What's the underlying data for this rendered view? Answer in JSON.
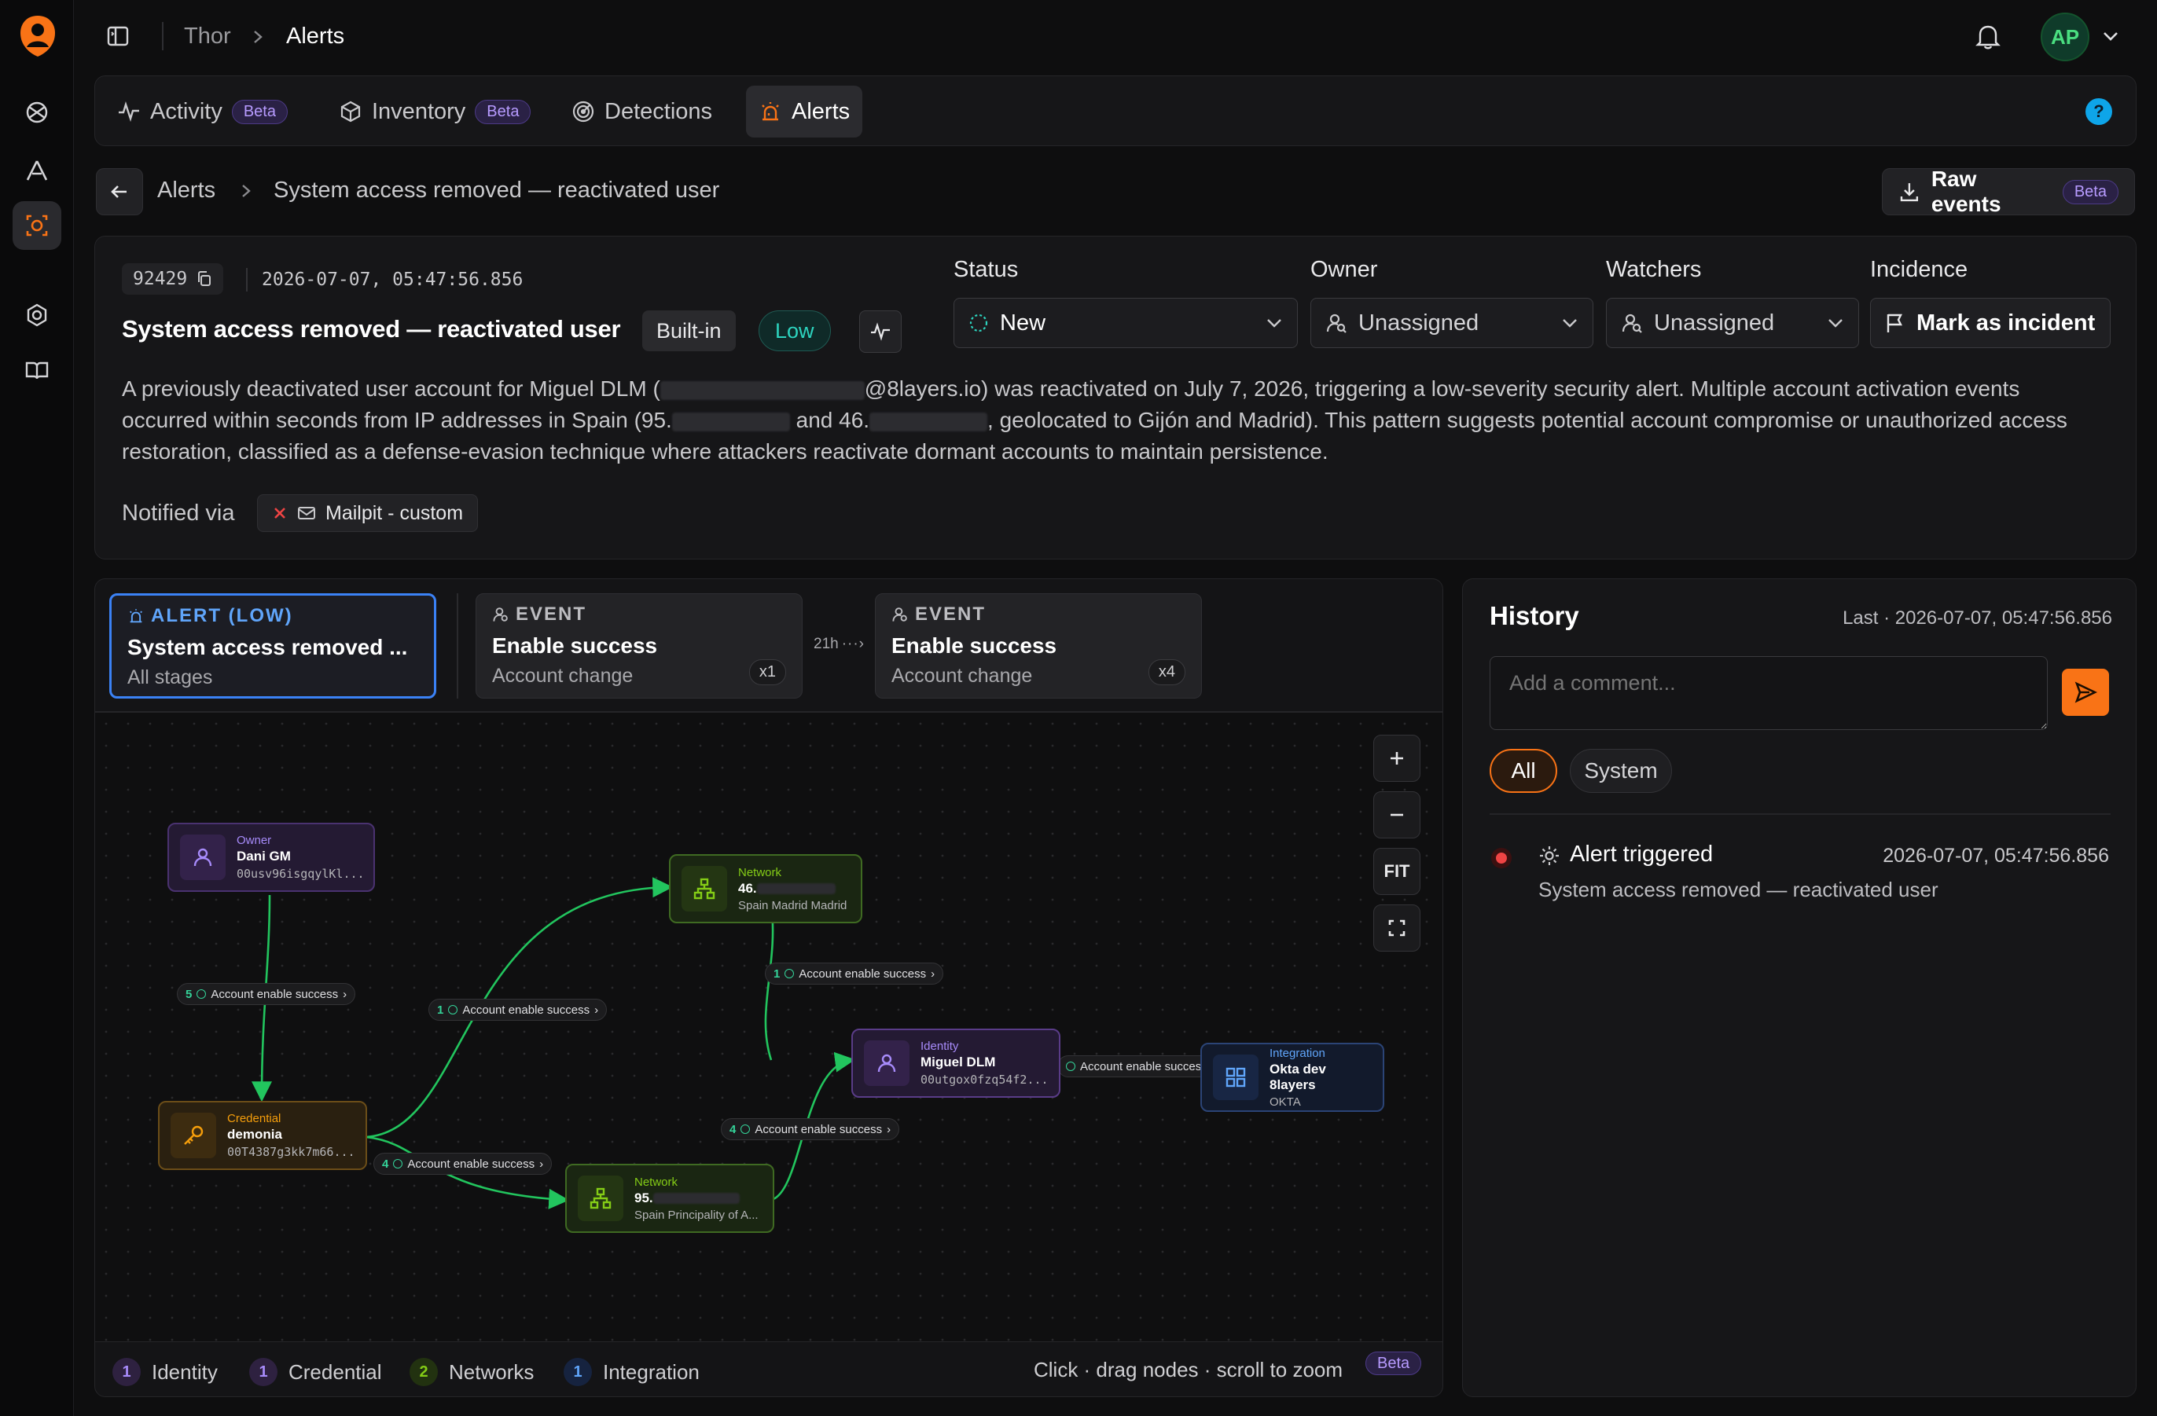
{
  "topbar": {
    "workspace": "Thor",
    "section": "Alerts",
    "avatar_initials": "AP"
  },
  "tabs": [
    {
      "label": "Activity",
      "badge": "Beta",
      "icon": "activity-icon"
    },
    {
      "label": "Inventory",
      "badge": "Beta",
      "icon": "cube-icon"
    },
    {
      "label": "Detections",
      "badge": "",
      "icon": "radar-icon"
    },
    {
      "label": "Alerts",
      "badge": "",
      "icon": "siren-icon",
      "active": true
    }
  ],
  "breadcrumb": {
    "parent": "Alerts",
    "current": "System access removed — reactivated user"
  },
  "raw_events": {
    "label": "Raw events",
    "badge": "Beta"
  },
  "alert": {
    "id": "92429",
    "timestamp": "2026-07-07, 05:47:56.856",
    "title": "System access removed — reactivated user",
    "type_badge": "Built-in",
    "severity": "Low",
    "description": {
      "p1": "A previously deactivated user account for Miguel DLM (",
      "p2": "@8layers.io) was reactivated on July 7, 2026, triggering a low-severity security alert. Multiple account activation events occurred within seconds from IP addresses in Spain (95.",
      "p3": " and 46.",
      "p4": ", geolocated to Gijón and Madrid). This pattern suggests potential account compromise or unauthorized access restoration, classified as a defense-evasion technique where attackers reactivate dormant accounts to maintain persistence."
    },
    "notified_label": "Notified via",
    "notified_channel": "Mailpit - custom"
  },
  "fields": {
    "status_label": "Status",
    "status_value": "New",
    "owner_label": "Owner",
    "owner_value": "Unassigned",
    "watchers_label": "Watchers",
    "watchers_value": "Unassigned",
    "incidence_label": "Incidence",
    "incidence_button": "Mark as incident"
  },
  "timeline": [
    {
      "kind": "ALERT (LOW)",
      "title": "System access removed ...",
      "sub": "All stages",
      "count": ""
    },
    {
      "kind": "EVENT",
      "title": "Enable success",
      "sub": "Account change",
      "count": "x1"
    },
    {
      "kind": "EVENT",
      "title": "Enable success",
      "sub": "Account change",
      "count": "x4"
    }
  ],
  "timeline_gap": "21h",
  "zoom": {
    "fit": "FIT"
  },
  "nodes": {
    "owner": {
      "type": "Owner",
      "name": "Dani GM",
      "sub": "00usv96isgqylKl..."
    },
    "credential": {
      "type": "Credential",
      "name": "demonia",
      "sub": "00T4387g3kk7m66..."
    },
    "network1": {
      "type": "Network",
      "name": "46.",
      "sub": "Spain Madrid Madrid"
    },
    "network2": {
      "type": "Network",
      "name": "95.",
      "sub": "Spain Principality of A..."
    },
    "identity": {
      "type": "Identity",
      "name": "Miguel DLM",
      "sub": "00utgox0fzq54f2..."
    },
    "integration": {
      "type": "Integration",
      "name": "Okta dev 8layers",
      "sub": "OKTA"
    }
  },
  "edges": [
    {
      "count": "5",
      "label": "Account enable success"
    },
    {
      "count": "1",
      "label": "Account enable success"
    },
    {
      "count": "1",
      "label": "Account enable success"
    },
    {
      "count": "4",
      "label": "Account enable success"
    },
    {
      "count": "4",
      "label": "Account enable success"
    },
    {
      "count": "",
      "label": "Account enable success"
    }
  ],
  "legend": [
    {
      "count": "1",
      "label": "Identity",
      "color": "#a78bfa"
    },
    {
      "count": "1",
      "label": "Credential",
      "color": "#a78bfa"
    },
    {
      "count": "2",
      "label": "Networks",
      "color": "#84cc16"
    },
    {
      "count": "1",
      "label": "Integration",
      "color": "#60a5fa"
    }
  ],
  "graph_hint": "Click · drag nodes · scroll to zoom",
  "graph_badge": "Beta",
  "history": {
    "title": "History",
    "last": "Last · 2026-07-07, 05:47:56.856",
    "comment_placeholder": "Add a comment...",
    "filter_all": "All",
    "filter_system": "System",
    "entry_title": "Alert triggered",
    "entry_time": "2026-07-07, 05:47:56.856",
    "entry_sub": "System access removed — reactivated user"
  },
  "colors": {
    "accent": "#f97316",
    "severity_low": "#2dd4bf",
    "selected": "#3b82f6",
    "edge": "#22c55e"
  }
}
